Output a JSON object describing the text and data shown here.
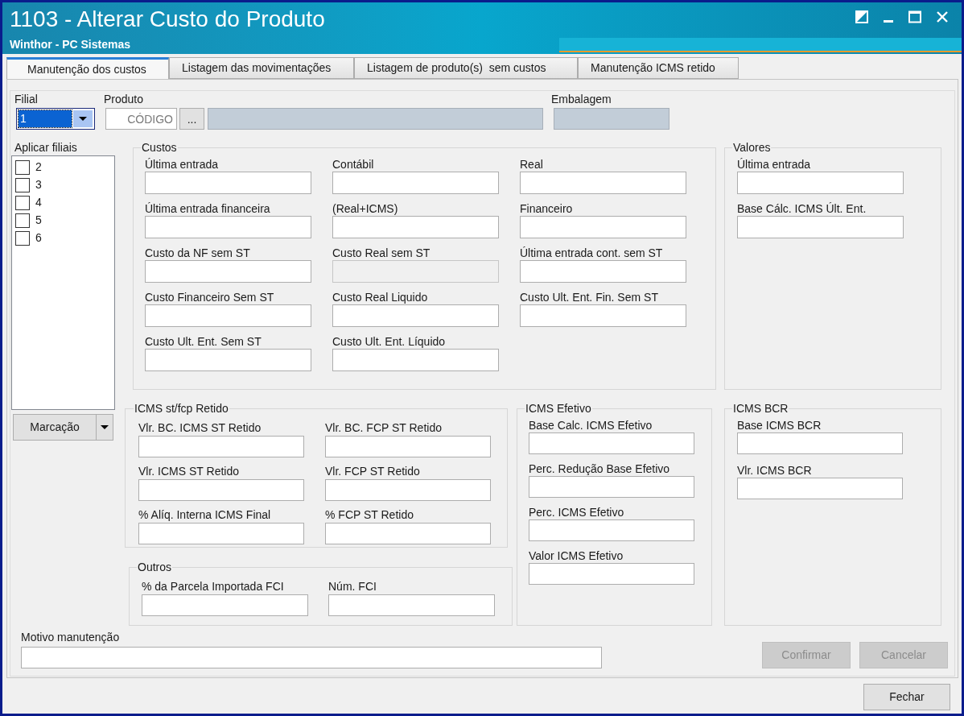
{
  "window": {
    "title": "1103 - Alterar Custo do Produto",
    "subtitle": "Winthor - PC Sistemas"
  },
  "tabs": [
    {
      "label": "Manutenção dos custos",
      "selected": true
    },
    {
      "label": "Listagem das movimentações",
      "selected": false
    },
    {
      "label": "Listagem de produto(s)  sem custos",
      "selected": false
    },
    {
      "label": "Manutenção ICMS retido",
      "selected": false
    }
  ],
  "filial": {
    "label": "Filial",
    "value": "1",
    "focused": true
  },
  "produto": {
    "label": "Produto",
    "code": {
      "placeholder": "CÓDIGO"
    },
    "browse_button": "...",
    "description": {
      "disabled": true
    }
  },
  "embalagem": {
    "label": "Embalagem",
    "disabled": true
  },
  "aplicar_filiais": {
    "label": "Aplicar filiais",
    "items": [
      {
        "label": "2",
        "checked": false
      },
      {
        "label": "3",
        "checked": false
      },
      {
        "label": "4",
        "checked": false
      },
      {
        "label": "5",
        "checked": false
      },
      {
        "label": "6",
        "checked": false
      }
    ]
  },
  "marcacao_button": {
    "label": "Marcação"
  },
  "custos": {
    "title": "Custos",
    "fields": [
      {
        "label": "Última entrada",
        "disabled": false
      },
      {
        "label": "Contábil",
        "disabled": false
      },
      {
        "label": "Real",
        "disabled": false
      },
      {
        "label": "Última entrada financeira",
        "disabled": false
      },
      {
        "label": "(Real+ICMS)",
        "disabled": false
      },
      {
        "label": "Financeiro",
        "disabled": false
      },
      {
        "label": "Custo da NF sem ST",
        "disabled": false
      },
      {
        "label": "Custo Real sem ST",
        "disabled": true
      },
      {
        "label": "Última entrada cont. sem ST",
        "disabled": false
      },
      {
        "label": "Custo Financeiro Sem ST",
        "disabled": false
      },
      {
        "label": "Custo Real Liquido",
        "disabled": false
      },
      {
        "label": "Custo Ult. Ent. Fin. Sem ST",
        "disabled": false
      },
      {
        "label": "Custo Ult. Ent. Sem ST",
        "disabled": false
      },
      {
        "label": "Custo Ult. Ent. Líquido",
        "disabled": false
      }
    ]
  },
  "valores": {
    "title": "Valores",
    "fields": [
      {
        "label": "Última entrada",
        "disabled": false
      },
      {
        "label": "Base Cálc. ICMS Últ. Ent.",
        "disabled": false
      }
    ]
  },
  "icms_st_fcp_retido": {
    "title": "ICMS st/fcp Retido",
    "fields": [
      {
        "label": "Vlr. BC. ICMS ST Retido",
        "disabled": false
      },
      {
        "label": "Vlr. BC. FCP ST Retido",
        "disabled": false
      },
      {
        "label": "Vlr. ICMS ST Retido",
        "disabled": false
      },
      {
        "label": "Vlr. FCP ST Retido",
        "disabled": false
      },
      {
        "label": "% Alíq. Interna ICMS Final",
        "disabled": false
      },
      {
        "label": "% FCP ST Retido",
        "disabled": false
      }
    ]
  },
  "outros": {
    "title": "Outros",
    "fields": [
      {
        "label": "% da Parcela Importada FCI",
        "disabled": false
      },
      {
        "label": "Núm. FCI",
        "disabled": false
      }
    ]
  },
  "icms_efetivo": {
    "title": "ICMS Efetivo",
    "fields": [
      {
        "label": "Base Calc. ICMS Efetivo",
        "disabled": false
      },
      {
        "label": "Perc. Redução Base Efetivo",
        "disabled": false
      },
      {
        "label": "Perc. ICMS Efetivo",
        "disabled": false
      },
      {
        "label": "Valor ICMS Efetivo",
        "disabled": false
      }
    ]
  },
  "icms_bcr": {
    "title": "ICMS BCR",
    "fields": [
      {
        "label": "Base ICMS BCR",
        "disabled": false
      },
      {
        "label": "Vlr. ICMS BCR",
        "disabled": false
      }
    ]
  },
  "motivo_manutencao": {
    "label": "Motivo manutenção"
  },
  "actions": [
    {
      "label": "Confirmar",
      "disabled": true
    },
    {
      "label": "Cancelar",
      "disabled": true
    }
  ],
  "close_button": {
    "label": "Fechar",
    "disabled": false
  }
}
